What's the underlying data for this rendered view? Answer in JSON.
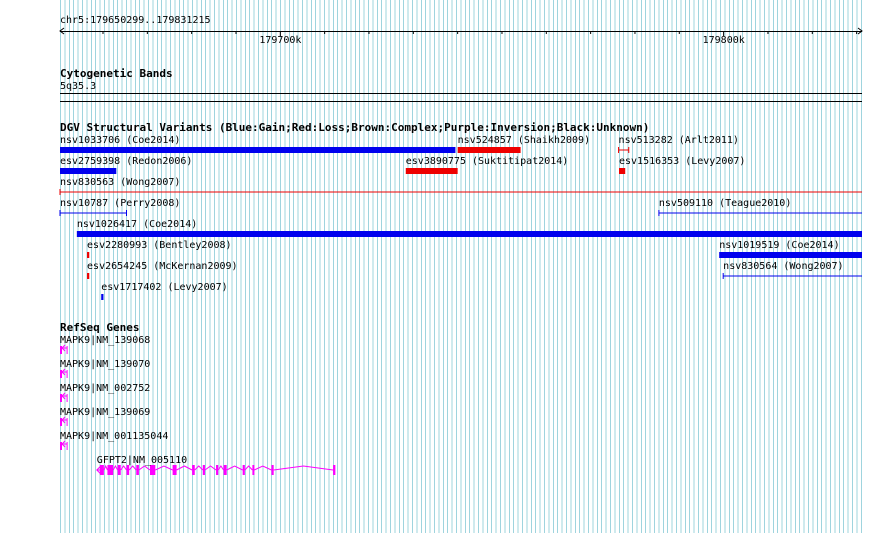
{
  "ruler": {
    "position_label": "chr5:179650299..179831215",
    "ticks": [
      {
        "bp": 179700000,
        "label": "179700k"
      },
      {
        "bp": 179800000,
        "label": "179800k"
      }
    ]
  },
  "cytoband": {
    "title": "Cytogenetic Bands",
    "band": "5q35.3"
  },
  "dgv": {
    "title": "DGV Structural Variants (Blue:Gain;Red:Loss;Brown:Complex;Purple:Inversion;Black:Unknown)",
    "colors": {
      "gain": "#0000ee",
      "loss": "#ee0000"
    },
    "features": [
      {
        "id": "nsv1033706",
        "label": "nsv1033706 (Coe2014)",
        "start": 179650299,
        "end": 179739500,
        "type": "gain",
        "style": "bar",
        "row": 0
      },
      {
        "id": "nsv524857",
        "label": "nsv524857 (Shaikh2009)",
        "start": 179740000,
        "end": 179754200,
        "type": "loss",
        "style": "bar",
        "row": 0
      },
      {
        "id": "nsv513282",
        "label": "nsv513282 (Arlt2011)",
        "start": 179776300,
        "end": 179778600,
        "type": "loss",
        "style": "line",
        "row": 0
      },
      {
        "id": "esv2759398",
        "label": "esv2759398 (Redon2006)",
        "start": 179650299,
        "end": 179663000,
        "type": "gain",
        "style": "bar",
        "row": 1
      },
      {
        "id": "esv3890775",
        "label": "esv3890775 (Suktitipat2014)",
        "start": 179728300,
        "end": 179740000,
        "type": "loss",
        "style": "bar",
        "row": 1
      },
      {
        "id": "esv1516353",
        "label": "esv1516353 (Levy2007)",
        "start": 179776400,
        "end": 179777800,
        "type": "loss",
        "style": "bar",
        "row": 1
      },
      {
        "id": "nsv830563",
        "label": "nsv830563 (Wong2007)",
        "start": 179650299,
        "end": 179831215,
        "type": "loss",
        "style": "line",
        "row": 2
      },
      {
        "id": "nsv10787",
        "label": "nsv10787 (Perry2008)",
        "start": 179650299,
        "end": 179665300,
        "type": "gain",
        "style": "line",
        "row": 3
      },
      {
        "id": "nsv509110",
        "label": "nsv509110 (Teague2010)",
        "start": 179785400,
        "end": 179831215,
        "type": "gain",
        "style": "line",
        "row": 3
      },
      {
        "id": "nsv1026417",
        "label": "nsv1026417 (Coe2014)",
        "start": 179654100,
        "end": 179831215,
        "type": "gain",
        "style": "bar",
        "row": 4
      },
      {
        "id": "esv2280993",
        "label": "esv2280993 (Bentley2008)",
        "start": 179656400,
        "end": 179656900,
        "type": "loss",
        "style": "bar",
        "row": 5
      },
      {
        "id": "nsv1019519",
        "label": "nsv1019519 (Coe2014)",
        "start": 179799000,
        "end": 179831215,
        "type": "gain",
        "style": "bar",
        "row": 5
      },
      {
        "id": "esv2654245",
        "label": "esv2654245 (McKernan2009)",
        "start": 179656400,
        "end": 179656900,
        "type": "loss",
        "style": "bar",
        "row": 6
      },
      {
        "id": "nsv830564",
        "label": "nsv830564 (Wong2007)",
        "start": 179799900,
        "end": 179831215,
        "type": "gain",
        "style": "line",
        "row": 6
      },
      {
        "id": "esv1717402",
        "label": "esv1717402 (Levy2007)",
        "start": 179659600,
        "end": 179660100,
        "type": "gain",
        "style": "bar",
        "row": 7
      }
    ]
  },
  "refseq": {
    "title": "RefSeq Genes",
    "color": "#ff00ff",
    "genes": [
      {
        "label": "MAPK9|NM_139068",
        "start": 179650299,
        "end": 179651900,
        "strand": "-",
        "exons": [
          [
            179650299,
            179651000
          ]
        ]
      },
      {
        "label": "MAPK9|NM_139070",
        "start": 179650299,
        "end": 179651900,
        "strand": "-",
        "exons": [
          [
            179650299,
            179651000
          ]
        ]
      },
      {
        "label": "MAPK9|NM_002752",
        "start": 179650299,
        "end": 179651900,
        "strand": "-",
        "exons": [
          [
            179650299,
            179651000
          ]
        ]
      },
      {
        "label": "MAPK9|NM_139069",
        "start": 179650299,
        "end": 179651900,
        "strand": "-",
        "exons": [
          [
            179650299,
            179651000
          ]
        ]
      },
      {
        "label": "MAPK9|NM_001135044",
        "start": 179650299,
        "end": 179651900,
        "strand": "-",
        "exons": [
          [
            179650299,
            179651000
          ]
        ]
      },
      {
        "label": "GFPT2|NM_005110",
        "start": 179658600,
        "end": 179712300,
        "strand": "-",
        "exons": [
          [
            179659300,
            179660200
          ],
          [
            179661000,
            179662300
          ],
          [
            179663300,
            179664000
          ],
          [
            179665300,
            179665900
          ],
          [
            179667500,
            179668100
          ],
          [
            179670600,
            179671800
          ],
          [
            179675700,
            179676600
          ],
          [
            179680100,
            179680700
          ],
          [
            179682500,
            179683000
          ],
          [
            179685500,
            179686000
          ],
          [
            179687200,
            179687900
          ],
          [
            179691500,
            179692000
          ],
          [
            179693700,
            179694100
          ],
          [
            179698000,
            179698500
          ],
          [
            179711900,
            179712300
          ]
        ]
      }
    ]
  }
}
